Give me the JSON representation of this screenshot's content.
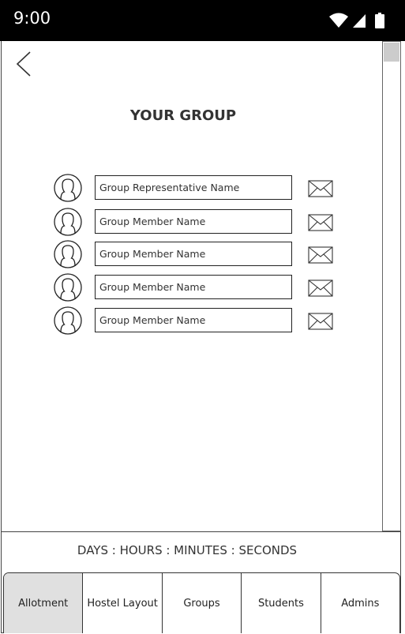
{
  "status_bar": {
    "time": "9:00",
    "icons": [
      "wifi-icon",
      "cellular-signal-icon",
      "battery-icon"
    ]
  },
  "header": {
    "back_icon": "chevron-left-icon",
    "title": "YOUR GROUP"
  },
  "members": [
    {
      "name": "Group Representative Name",
      "avatar_icon": "user-avatar-icon",
      "action_icon": "envelope-icon"
    },
    {
      "name": "Group Member Name",
      "avatar_icon": "user-avatar-icon",
      "action_icon": "envelope-icon"
    },
    {
      "name": "Group Member Name",
      "avatar_icon": "user-avatar-icon",
      "action_icon": "envelope-icon"
    },
    {
      "name": "Group Member Name",
      "avatar_icon": "user-avatar-icon",
      "action_icon": "envelope-icon"
    },
    {
      "name": "Group Member Name",
      "avatar_icon": "user-avatar-icon",
      "action_icon": "envelope-icon"
    }
  ],
  "timer": {
    "label": "DAYS : HOURS : MINUTES : SECONDS"
  },
  "tabs": [
    {
      "label": "Allotment",
      "active": true
    },
    {
      "label": "Hostel Layout",
      "active": false
    },
    {
      "label": "Groups",
      "active": false
    },
    {
      "label": "Students",
      "active": false
    },
    {
      "label": "Admins",
      "active": false
    }
  ],
  "colors": {
    "status_bar_bg": "#000000",
    "active_tab_bg": "#e0e0e0",
    "border": "#333333"
  }
}
